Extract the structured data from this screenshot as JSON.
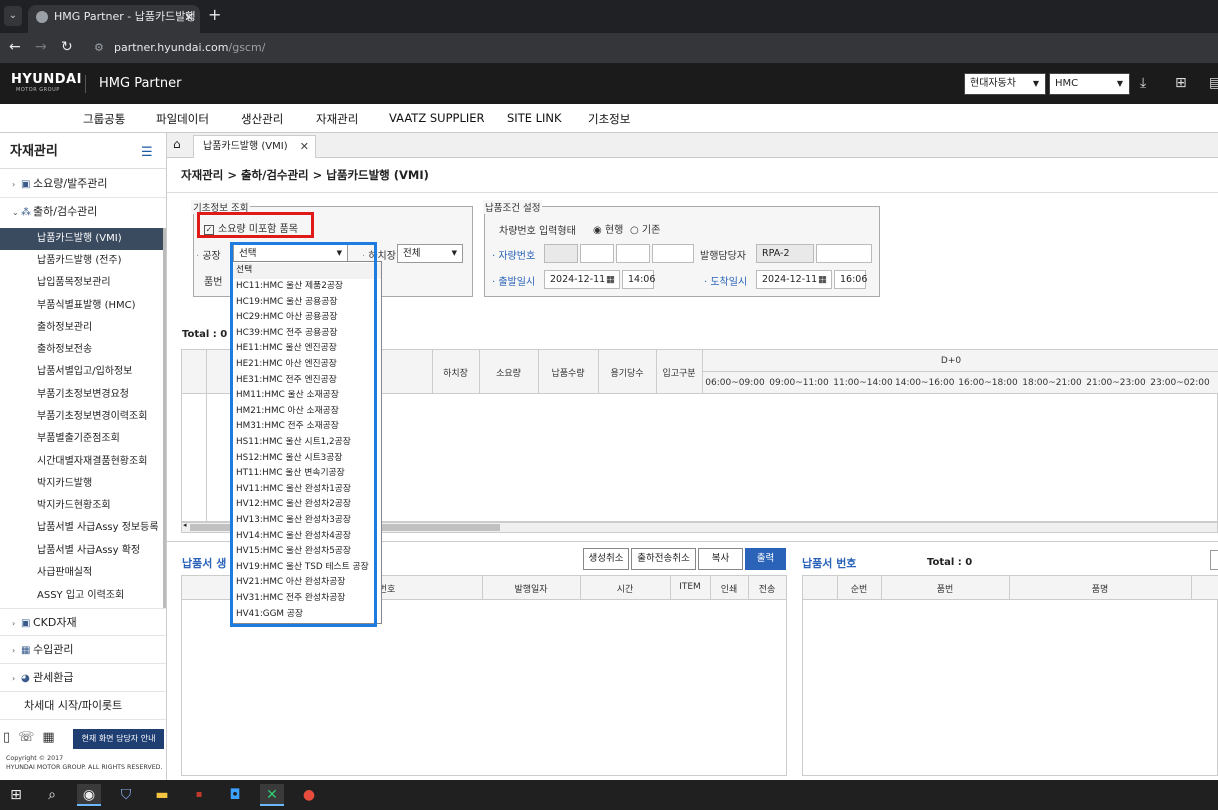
{
  "browser": {
    "tab_title": "HMG Partner - 납품카드발행 (",
    "tab_close": "✕",
    "new_tab": "+",
    "url_host": "partner.hyundai.com",
    "url_path": "/gscm/"
  },
  "header": {
    "logo": "HYUNDAI",
    "logo_sub": "MOTOR GROUP",
    "app_title": "HMG Partner",
    "company_select": "현대자동차",
    "plant_select": "HMC"
  },
  "menu": [
    "그룹공통",
    "파일데이터",
    "생산관리",
    "자재관리",
    "VAATZ SUPPLIER",
    "SITE LINK",
    "기초정보"
  ],
  "sidebar": {
    "title": "자재관리",
    "groups": [
      {
        "label": "소요량/발주관리"
      },
      {
        "label": "출하/검수관리"
      },
      {
        "label": "CKD자재"
      },
      {
        "label": "수입관리"
      },
      {
        "label": "관세환급"
      }
    ],
    "items": [
      "납품카드발행 (VMI)",
      "납품카드발행 (전주)",
      "납입품목정보관리",
      "부품식별표발행 (HMC)",
      "출하정보관리",
      "출하정보전송",
      "납품서별입고/입하정보",
      "부품기초정보변경요청",
      "부품기초정보변경이력조회",
      "부품별출기준점조회",
      "시간대별자재결품현황조회",
      "박지카드발행",
      "박지카드현황조회",
      "납품서별 사급Assy 정보등록",
      "납품서별 사급Assy 확정",
      "사급판매실적",
      "ASSY 입고 이력조회"
    ],
    "bottom_item": "차세대 시작/파이롯트",
    "notice_button": "현재 화면 담당자 안내",
    "copyright_1": "Copyright © 2017",
    "copyright_2": "HYUNDAI MOTOR GROUP. ALL RIGHTS RESERVED."
  },
  "page": {
    "tab_label": "납품카드발행 (VMI)",
    "breadcrumb": "자재관리 > 출하/검수관리 > 납품카드발행 (VMI)"
  },
  "basic_query": {
    "legend": "기초정보 조회",
    "checkbox_label": "소요량 미포함 품목",
    "plant_label": "공장",
    "plant_value": "선택",
    "dock_label": "하치장",
    "dock_value": "전체",
    "part_label": "품번"
  },
  "delivery_cond": {
    "legend": "납품조건 설정",
    "vehicle_input_label": "차량번호 입력형태",
    "radio_current": "현행",
    "radio_old": "기존",
    "vehicle_no_label": "자량번호",
    "issuer_label": "발행담당자",
    "issuer_value": "RPA-2",
    "depart_label": "출발일시",
    "depart_date": "2024-12-11",
    "depart_time": "14:06",
    "arrive_label": "도착일시",
    "arrive_date": "2024-12-11",
    "arrive_time": "16:06"
  },
  "grid1": {
    "total": "Total : 0",
    "columns": [
      "하치장",
      "소요량",
      "납품수량",
      "용기당수",
      "입고구분"
    ],
    "day_header": "D+0",
    "time_slots": [
      "06:00~09:00",
      "09:00~11:00",
      "11:00~14:00",
      "14:00~16:00",
      "16:00~18:00",
      "18:00~21:00",
      "21:00~23:00",
      "23:00~02:00"
    ]
  },
  "section2": {
    "title": "납품서 생",
    "buttons": [
      "생성취소",
      "출하전송취소",
      "복사",
      "출력"
    ],
    "columns": [
      "번호",
      "발행일자",
      "시간",
      "ITEM",
      "인쇄",
      "전송"
    ]
  },
  "section3": {
    "title": "납품서 번호",
    "total": "Total : 0",
    "columns": [
      "순번",
      "품번",
      "품명"
    ]
  },
  "dropdown": {
    "options": [
      "선택",
      "HC11:HMC 울산 제품2공장",
      "HC19:HMC 울산 공용공장",
      "HC29:HMC 아산 공용공장",
      "HC39:HMC 전주 공용공장",
      "HE11:HMC 울산 엔진공장",
      "HE21:HMC 아산 엔진공장",
      "HE31:HMC 전주 엔진공장",
      "HM11:HMC 울산 소재공장",
      "HM21:HMC 아산 소재공장",
      "HM31:HMC 전주 소재공장",
      "HS11:HMC 울산 시트1,2공장",
      "HS12:HMC 울산 시트3공장",
      "HT11:HMC 울산 변속기공장",
      "HV11:HMC 울산 완성차1공장",
      "HV12:HMC 울산 완성차2공장",
      "HV13:HMC 울산 완성차3공장",
      "HV14:HMC 울산 완성차4공장",
      "HV15:HMC 울산 완성차5공장",
      "HV19:HMC 울산 TSD 테스트 공장",
      "HV21:HMC 아산 완성차공장",
      "HV31:HMC 전주 완성차공장",
      "HV41:GGM 공장"
    ]
  },
  "colors": {
    "accent": "#2a63b8",
    "highlight_red": "#e01919",
    "highlight_blue": "#1e7be0",
    "sidebar_active": "#3a4a5f"
  }
}
